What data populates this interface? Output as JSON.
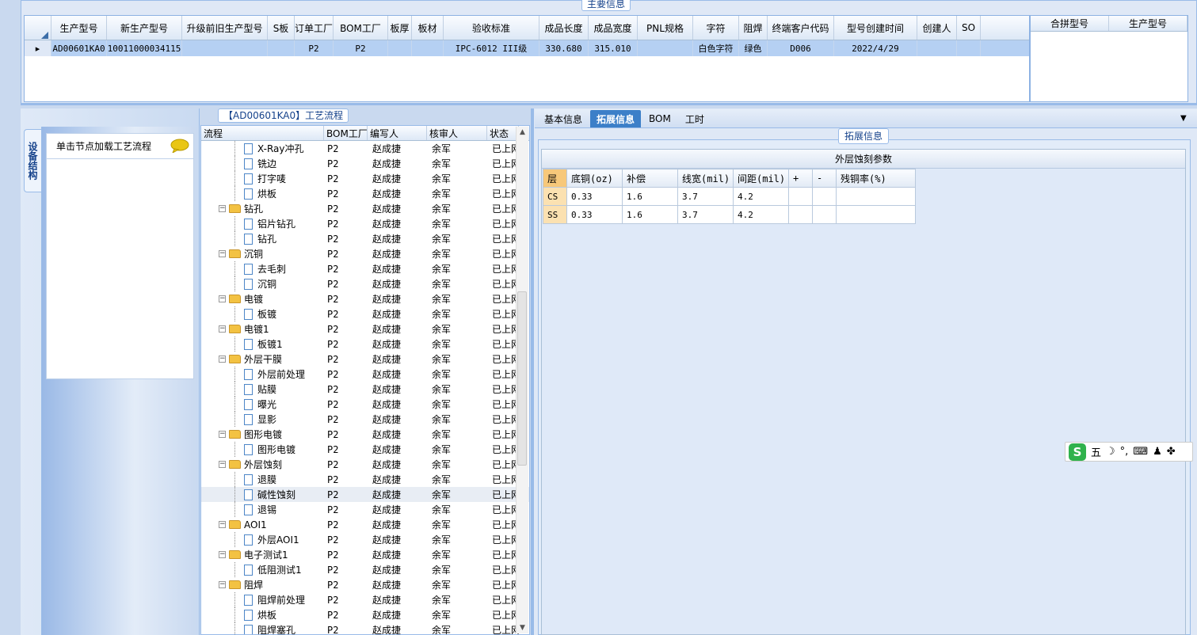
{
  "top": {
    "group_title": "主要信息",
    "columns": [
      "生产型号",
      "新生产型号",
      "升级前旧生产型号",
      "S板",
      "订单工厂",
      "BOM工厂",
      "板厚",
      "板材",
      "验收标准",
      "成品长度",
      "成品宽度",
      "PNL规格",
      "字符",
      "阻焊",
      "终端客户代码",
      "型号创建时间",
      "创建人",
      "SO"
    ],
    "row": [
      "AD00601KA0",
      "10011000034115",
      "",
      "",
      "P2",
      "P2",
      "",
      "",
      "IPC-6012 III级",
      "330.680",
      "315.010",
      "",
      "白色字符",
      "绿色",
      "D006",
      "2022/4/29",
      "",
      ""
    ],
    "merge_columns": [
      "合拼型号",
      "生产型号"
    ]
  },
  "sidebar": {
    "vtab_label": "设备结构",
    "header_text": "单击节点加载工艺流程"
  },
  "tree": {
    "group_title": "【AD00601KA0】工艺流程",
    "columns": [
      "流程",
      "BOM工厂",
      "编写人",
      "核审人",
      "状态"
    ],
    "rows": [
      {
        "name": "X-Ray冲孔",
        "type": "doc",
        "bom": "P2",
        "writer": "赵成捷",
        "reviewer": "余军",
        "status": "已上网"
      },
      {
        "name": "铣边",
        "type": "doc",
        "bom": "P2",
        "writer": "赵成捷",
        "reviewer": "余军",
        "status": "已上网"
      },
      {
        "name": "打字唛",
        "type": "doc",
        "bom": "P2",
        "writer": "赵成捷",
        "reviewer": "余军",
        "status": "已上网"
      },
      {
        "name": "烘板",
        "type": "doc",
        "bom": "P2",
        "writer": "赵成捷",
        "reviewer": "余军",
        "status": "已上网"
      },
      {
        "name": "钻孔",
        "type": "folder",
        "bom": "P2",
        "writer": "赵成捷",
        "reviewer": "余军",
        "status": "已上网"
      },
      {
        "name": "铝片钻孔",
        "type": "doc",
        "bom": "P2",
        "writer": "赵成捷",
        "reviewer": "余军",
        "status": "已上网"
      },
      {
        "name": "钻孔",
        "type": "doc",
        "bom": "P2",
        "writer": "赵成捷",
        "reviewer": "余军",
        "status": "已上网"
      },
      {
        "name": "沉铜",
        "type": "folder",
        "bom": "P2",
        "writer": "赵成捷",
        "reviewer": "余军",
        "status": "已上网"
      },
      {
        "name": "去毛刺",
        "type": "doc",
        "bom": "P2",
        "writer": "赵成捷",
        "reviewer": "余军",
        "status": "已上网"
      },
      {
        "name": "沉铜",
        "type": "doc",
        "bom": "P2",
        "writer": "赵成捷",
        "reviewer": "余军",
        "status": "已上网"
      },
      {
        "name": "电镀",
        "type": "folder",
        "bom": "P2",
        "writer": "赵成捷",
        "reviewer": "余军",
        "status": "已上网"
      },
      {
        "name": "板镀",
        "type": "doc",
        "bom": "P2",
        "writer": "赵成捷",
        "reviewer": "余军",
        "status": "已上网"
      },
      {
        "name": "电镀1",
        "type": "folder",
        "bom": "P2",
        "writer": "赵成捷",
        "reviewer": "余军",
        "status": "已上网"
      },
      {
        "name": "板镀1",
        "type": "doc",
        "bom": "P2",
        "writer": "赵成捷",
        "reviewer": "余军",
        "status": "已上网"
      },
      {
        "name": "外层干膜",
        "type": "folder",
        "bom": "P2",
        "writer": "赵成捷",
        "reviewer": "余军",
        "status": "已上网"
      },
      {
        "name": "外层前处理",
        "type": "doc",
        "bom": "P2",
        "writer": "赵成捷",
        "reviewer": "余军",
        "status": "已上网"
      },
      {
        "name": "贴膜",
        "type": "doc",
        "bom": "P2",
        "writer": "赵成捷",
        "reviewer": "余军",
        "status": "已上网"
      },
      {
        "name": "曝光",
        "type": "doc",
        "bom": "P2",
        "writer": "赵成捷",
        "reviewer": "余军",
        "status": "已上网"
      },
      {
        "name": "显影",
        "type": "doc",
        "bom": "P2",
        "writer": "赵成捷",
        "reviewer": "余军",
        "status": "已上网"
      },
      {
        "name": "图形电镀",
        "type": "folder",
        "bom": "P2",
        "writer": "赵成捷",
        "reviewer": "余军",
        "status": "已上网"
      },
      {
        "name": "图形电镀",
        "type": "doc",
        "bom": "P2",
        "writer": "赵成捷",
        "reviewer": "余军",
        "status": "已上网"
      },
      {
        "name": "外层蚀刻",
        "type": "folder",
        "bom": "P2",
        "writer": "赵成捷",
        "reviewer": "余军",
        "status": "已上网"
      },
      {
        "name": "退膜",
        "type": "doc",
        "bom": "P2",
        "writer": "赵成捷",
        "reviewer": "余军",
        "status": "已上网"
      },
      {
        "name": "碱性蚀刻",
        "type": "doc",
        "bom": "P2",
        "writer": "赵成捷",
        "reviewer": "余军",
        "status": "已上网",
        "selected": true
      },
      {
        "name": "退锡",
        "type": "doc",
        "bom": "P2",
        "writer": "赵成捷",
        "reviewer": "余军",
        "status": "已上网"
      },
      {
        "name": "AOI1",
        "type": "folder",
        "bom": "P2",
        "writer": "赵成捷",
        "reviewer": "余军",
        "status": "已上网"
      },
      {
        "name": "外层AOI1",
        "type": "doc",
        "bom": "P2",
        "writer": "赵成捷",
        "reviewer": "余军",
        "status": "已上网"
      },
      {
        "name": "电子测试1",
        "type": "folder",
        "bom": "P2",
        "writer": "赵成捷",
        "reviewer": "余军",
        "status": "已上网"
      },
      {
        "name": "低阻测试1",
        "type": "doc",
        "bom": "P2",
        "writer": "赵成捷",
        "reviewer": "余军",
        "status": "已上网"
      },
      {
        "name": "阻焊",
        "type": "folder",
        "bom": "P2",
        "writer": "赵成捷",
        "reviewer": "余军",
        "status": "已上网"
      },
      {
        "name": "阻焊前处理",
        "type": "doc",
        "bom": "P2",
        "writer": "赵成捷",
        "reviewer": "余军",
        "status": "已上网"
      },
      {
        "name": "烘板",
        "type": "doc",
        "bom": "P2",
        "writer": "赵成捷",
        "reviewer": "余军",
        "status": "已上网"
      },
      {
        "name": "阻焊塞孔",
        "type": "doc",
        "bom": "P2",
        "writer": "赵成捷",
        "reviewer": "余军",
        "status": "已上网"
      }
    ]
  },
  "tabs": [
    "基本信息",
    "拓展信息",
    "BOM",
    "工时"
  ],
  "active_tab": 1,
  "ext": {
    "group_title": "拓展信息",
    "etch_title": "外层蚀刻参数",
    "columns": [
      "层",
      "底铜(oz)",
      "补偿",
      "线宽(mil)",
      "间距(mil)",
      "+",
      "-",
      "残铜率(%)"
    ],
    "rows": [
      [
        "CS",
        "0.33",
        "1.6",
        "3.7",
        "4.2",
        "",
        "",
        ""
      ],
      [
        "SS",
        "0.33",
        "1.6",
        "3.7",
        "4.2",
        "",
        "",
        ""
      ]
    ]
  },
  "ime": {
    "logo": "S",
    "mode": "五"
  },
  "colors": {
    "accent": "#3c7fc8",
    "selected_row": "#b5d0f3",
    "border": "#99bbe8"
  }
}
